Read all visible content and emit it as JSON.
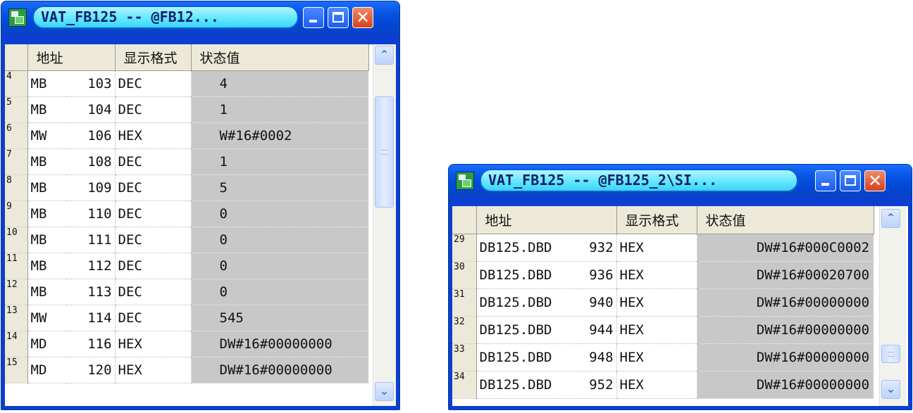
{
  "window1": {
    "title": "VAT_FB125 -- @FB12...",
    "columns": [
      "地址",
      "显示格式",
      "状态值"
    ],
    "rows": [
      {
        "num": "4",
        "op": "MB",
        "addr": "103",
        "fmt": "DEC",
        "val": "4"
      },
      {
        "num": "5",
        "op": "MB",
        "addr": "104",
        "fmt": "DEC",
        "val": "1"
      },
      {
        "num": "6",
        "op": "MW",
        "addr": "106",
        "fmt": "HEX",
        "val": "W#16#0002"
      },
      {
        "num": "7",
        "op": "MB",
        "addr": "108",
        "fmt": "DEC",
        "val": "1"
      },
      {
        "num": "8",
        "op": "MB",
        "addr": "109",
        "fmt": "DEC",
        "val": "5"
      },
      {
        "num": "9",
        "op": "MB",
        "addr": "110",
        "fmt": "DEC",
        "val": "0"
      },
      {
        "num": "10",
        "op": "MB",
        "addr": "111",
        "fmt": "DEC",
        "val": "0"
      },
      {
        "num": "11",
        "op": "MB",
        "addr": "112",
        "fmt": "DEC",
        "val": "0"
      },
      {
        "num": "12",
        "op": "MB",
        "addr": "113",
        "fmt": "DEC",
        "val": "0"
      },
      {
        "num": "13",
        "op": "MW",
        "addr": "114",
        "fmt": "DEC",
        "val": "545"
      },
      {
        "num": "14",
        "op": "MD",
        "addr": "116",
        "fmt": "HEX",
        "val": "DW#16#00000000"
      },
      {
        "num": "15",
        "op": "MD",
        "addr": "120",
        "fmt": "HEX",
        "val": "DW#16#00000000"
      }
    ]
  },
  "window2": {
    "title": "VAT_FB125 -- @FB125_2\\SI...",
    "columns": [
      "地址",
      "显示格式",
      "状态值"
    ],
    "rows": [
      {
        "num": "29",
        "op": "DB125.DBD",
        "addr": "932",
        "fmt": "HEX",
        "val": "DW#16#000C0002"
      },
      {
        "num": "30",
        "op": "DB125.DBD",
        "addr": "936",
        "fmt": "HEX",
        "val": "DW#16#00020700"
      },
      {
        "num": "31",
        "op": "DB125.DBD",
        "addr": "940",
        "fmt": "HEX",
        "val": "DW#16#00000000"
      },
      {
        "num": "32",
        "op": "DB125.DBD",
        "addr": "944",
        "fmt": "HEX",
        "val": "DW#16#00000000"
      },
      {
        "num": "33",
        "op": "DB125.DBD",
        "addr": "948",
        "fmt": "HEX",
        "val": "DW#16#00000000"
      },
      {
        "num": "34",
        "op": "DB125.DBD",
        "addr": "952",
        "fmt": "HEX",
        "val": "DW#16#00000000"
      }
    ]
  },
  "icons": {
    "app": "vat-app-icon",
    "minimize": "minimize-icon",
    "maximize": "maximize-icon",
    "close": "close-icon",
    "scroll_up": "scroll-up-arrow-icon",
    "scroll_down": "scroll-down-arrow-icon"
  },
  "colors": {
    "titlebar": "#0a52e6",
    "title_pill": "#5ee6ff",
    "value_cell": "#c8c8c8",
    "header": "#ece9d8",
    "close_button": "#d7401c"
  }
}
